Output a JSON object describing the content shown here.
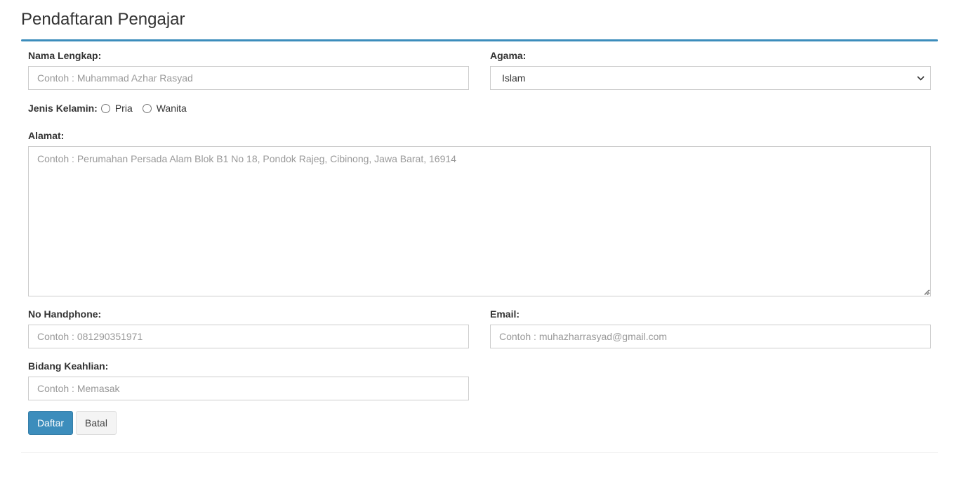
{
  "page": {
    "title": "Pendaftaran Pengajar"
  },
  "form": {
    "nama": {
      "label": "Nama Lengkap:",
      "placeholder": "Contoh : Muhammad Azhar Rasyad",
      "value": ""
    },
    "agama": {
      "label": "Agama:",
      "selected": "Islam"
    },
    "jenis_kelamin": {
      "label": "Jenis Kelamin:",
      "options": [
        "Pria",
        "Wanita"
      ]
    },
    "alamat": {
      "label": "Alamat:",
      "placeholder": "Contoh : Perumahan Persada Alam Blok B1 No 18, Pondok Rajeg, Cibinong, Jawa Barat, 16914",
      "value": ""
    },
    "handphone": {
      "label": "No Handphone:",
      "placeholder": "Contoh : 081290351971",
      "value": ""
    },
    "email": {
      "label": "Email:",
      "placeholder": "Contoh : muhazharrasyad@gmail.com",
      "value": ""
    },
    "keahlian": {
      "label": "Bidang Keahlian:",
      "placeholder": "Contoh : Memasak",
      "value": ""
    }
  },
  "buttons": {
    "submit": "Daftar",
    "cancel": "Batal"
  },
  "colors": {
    "accent": "#3c8dbc",
    "border": "#cccccc"
  },
  "icons": {
    "select_arrow": "chevron-down-icon",
    "textarea_resize": "resize-grip-icon"
  }
}
